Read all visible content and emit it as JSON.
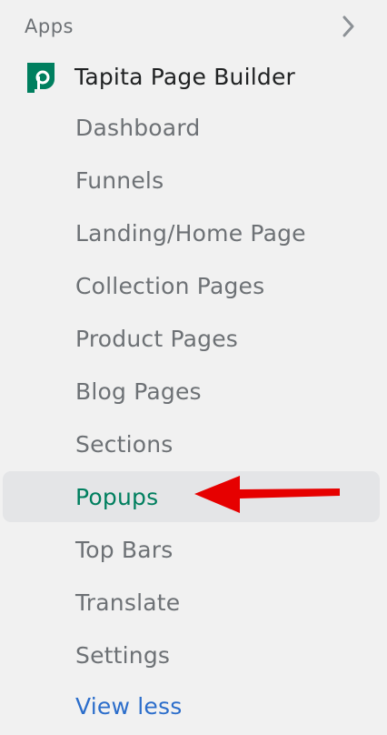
{
  "header": {
    "section_label": "Apps",
    "expand_icon": "chevron-right-icon"
  },
  "app": {
    "title": "Tapita Page Builder",
    "icon": "tapita-logo-icon",
    "brand_color": "#007f5f"
  },
  "nav": {
    "items": [
      {
        "label": "Dashboard",
        "active": false
      },
      {
        "label": "Funnels",
        "active": false
      },
      {
        "label": "Landing/Home Page",
        "active": false
      },
      {
        "label": "Collection Pages",
        "active": false
      },
      {
        "label": "Product Pages",
        "active": false
      },
      {
        "label": "Blog Pages",
        "active": false
      },
      {
        "label": "Sections",
        "active": false
      },
      {
        "label": "Popups",
        "active": true
      },
      {
        "label": "Top Bars",
        "active": false
      },
      {
        "label": "Translate",
        "active": false
      },
      {
        "label": "Settings",
        "active": false
      }
    ],
    "view_less": "View less"
  },
  "annotation": {
    "arrow_icon": "red-arrow-left-icon",
    "color": "#e60000"
  },
  "colors": {
    "active_text": "#007f5f",
    "link": "#2c6ecb",
    "text_muted": "#6d7175",
    "active_background": "#e4e5e7"
  }
}
